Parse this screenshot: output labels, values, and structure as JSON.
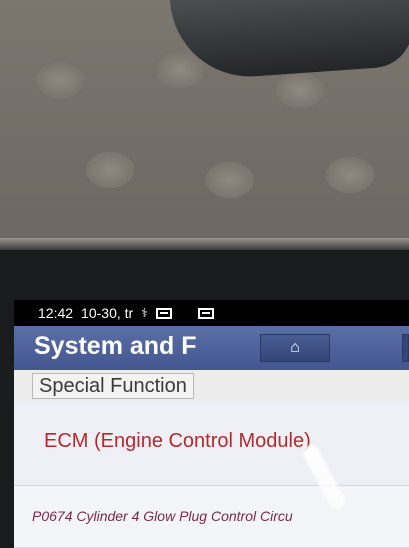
{
  "status_bar": {
    "time": "12:42",
    "date": "10-30, tr",
    "icons": [
      "usb-icon",
      "screenshot-icon",
      "gallery-icon"
    ]
  },
  "header": {
    "title": "System and F",
    "home_icon": "home-icon"
  },
  "breadcrumb": {
    "label": "Special Function"
  },
  "list": {
    "items": [
      {
        "label": "ECM (Engine Control Module)"
      },
      {
        "label": "P0674 Cylinder 4 Glow Plug Control Circu"
      }
    ]
  },
  "colors": {
    "header_bg": "#4a5d93",
    "item_primary_text": "#b52a2a",
    "item_secondary_text": "#7a2b45"
  }
}
